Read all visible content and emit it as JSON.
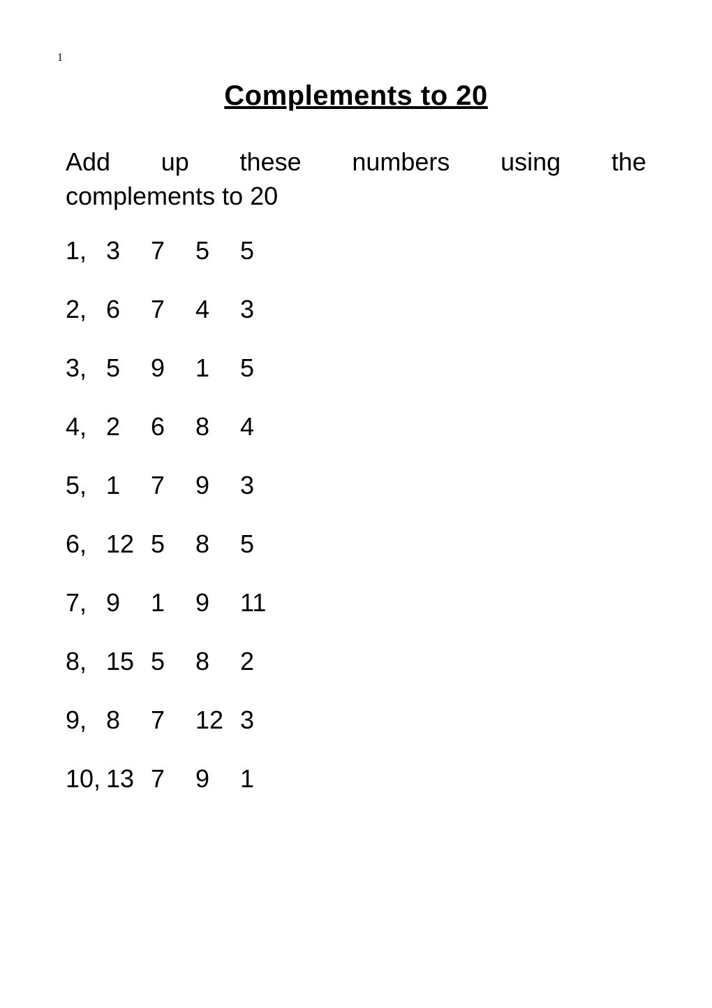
{
  "page_number": "1",
  "title": "Complements to 20",
  "instructions": {
    "w1": "Add",
    "w2": "up",
    "w3": "these",
    "w4": "numbers",
    "w5": "using",
    "w6": "the",
    "line2": "complements to 20"
  },
  "problems": [
    {
      "idx": "1,",
      "a": "3",
      "b": "7",
      "c": "5",
      "d": "5"
    },
    {
      "idx": "2,",
      "a": "6",
      "b": "7",
      "c": "4",
      "d": "3"
    },
    {
      "idx": "3,",
      "a": "5",
      "b": "9",
      "c": "1",
      "d": "5"
    },
    {
      "idx": "4,",
      "a": "2",
      "b": "6",
      "c": "8",
      "d": "4"
    },
    {
      "idx": "5,",
      "a": "1",
      "b": "7",
      "c": "9",
      "d": "3"
    },
    {
      "idx": "6,",
      "a": "12",
      "b": "5",
      "c": "8",
      "d": "5"
    },
    {
      "idx": "7,",
      "a": "9",
      "b": "1",
      "c": "9",
      "d": "11"
    },
    {
      "idx": "8,",
      "a": "15",
      "b": "5",
      "c": "8",
      "d": "2"
    },
    {
      "idx": "9,",
      "a": "8",
      "b": "7",
      "c": "12",
      "d": "3"
    },
    {
      "idx": "10,",
      "a": "13",
      "b": "7",
      "c": "9",
      "d": "1"
    }
  ]
}
